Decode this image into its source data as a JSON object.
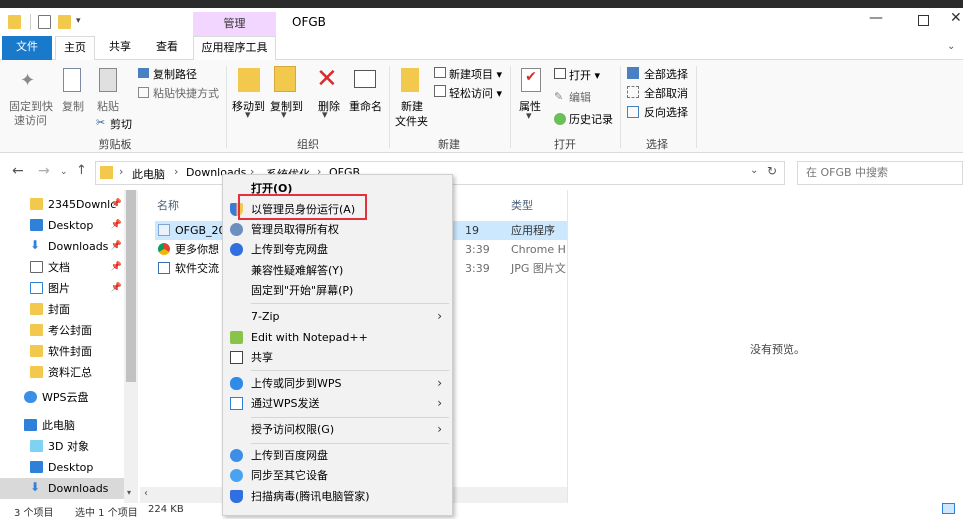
{
  "window": {
    "title": "OFGB",
    "context_tab_label": "管理",
    "colors": {
      "file_tab": "#1979ca",
      "context_tab": "#f2d6ff",
      "highlight": "#e3313d",
      "selected_row": "#cce8ff"
    }
  },
  "tabs": [
    {
      "label": "文件"
    },
    {
      "label": "主页"
    },
    {
      "label": "共享"
    },
    {
      "label": "查看"
    },
    {
      "label": "应用程序工具"
    }
  ],
  "ribbon": {
    "clipboard": {
      "pin_label_1": "固定到快",
      "pin_label_2": "速访问",
      "copy": "复制",
      "paste": "粘贴",
      "copy_path": "复制路径",
      "paste_shortcut": "粘贴快捷方式",
      "cut": "剪切",
      "group": "剪贴板"
    },
    "organize": {
      "move_to": "移动到",
      "copy_to": "复制到",
      "delete": "删除",
      "rename": "重命名",
      "group": "组织"
    },
    "new": {
      "new_folder_1": "新建",
      "new_folder_2": "文件夹",
      "new_item": "新建项目 ▾",
      "easy_access": "轻松访问 ▾",
      "group": "新建"
    },
    "open": {
      "properties": "属性",
      "open": "打开 ▾",
      "edit": "编辑",
      "history": "历史记录",
      "group": "打开"
    },
    "select": {
      "select_all": "全部选择",
      "select_none": "全部取消",
      "invert": "反向选择",
      "group": "选择"
    }
  },
  "address": {
    "segments": [
      "此电脑",
      "Downloads",
      "系统优化",
      "OFGB"
    ],
    "search_placeholder": "在 OFGB 中搜索"
  },
  "nav": {
    "items": [
      {
        "label": "2345Downlc",
        "icon": "folder-icon",
        "pinned": true
      },
      {
        "label": "Desktop",
        "icon": "desktop-icon",
        "pinned": true
      },
      {
        "label": "Downloads",
        "icon": "download-icon",
        "pinned": true
      },
      {
        "label": "文档",
        "icon": "document-icon",
        "pinned": true
      },
      {
        "label": "图片",
        "icon": "picture-icon",
        "pinned": true
      },
      {
        "label": "封面",
        "icon": "folder-icon",
        "pinned": false
      },
      {
        "label": "考公封面",
        "icon": "folder-icon",
        "pinned": false
      },
      {
        "label": "软件封面",
        "icon": "folder-icon",
        "pinned": false
      },
      {
        "label": "资料汇总",
        "icon": "folder-icon",
        "pinned": false
      },
      {
        "label": "WPS云盘",
        "icon": "cloud-icon",
        "pinned": false
      },
      {
        "label": "此电脑",
        "icon": "computer-icon",
        "pinned": false
      },
      {
        "label": "3D 对象",
        "icon": "3d-objects-icon",
        "pinned": false
      },
      {
        "label": "Desktop",
        "icon": "desktop-icon",
        "pinned": false
      },
      {
        "label": "Downloads",
        "icon": "download-icon",
        "pinned": false
      }
    ]
  },
  "files": {
    "col_name": "名称",
    "col_type": "类型",
    "rows": [
      {
        "name": "OFGB_20",
        "date": "19",
        "type": "应用程序",
        "icon": "app-icon"
      },
      {
        "name": "更多你想",
        "date": "3:39",
        "type": "Chrome H",
        "icon": "chrome-icon"
      },
      {
        "name": "软件交流",
        "date": "3:39",
        "type": "JPG 图片文",
        "icon": "jpg-icon"
      }
    ]
  },
  "preview": {
    "text": "没有预览。"
  },
  "status": {
    "count": "3 个项目",
    "selected": "选中 1 个项目",
    "size": "224 KB"
  },
  "context_menu": {
    "items": [
      {
        "label": "打开(O)",
        "bold": true
      },
      {
        "label": "以管理员身份运行(A)",
        "icon": "shield-icon"
      },
      {
        "label": "管理员取得所有权",
        "icon": "admin-icon"
      },
      {
        "label": "上传到夸克网盘",
        "icon": "quark-icon"
      },
      {
        "label": "兼容性疑难解答(Y)"
      },
      {
        "label": "固定到\"开始\"屏幕(P)"
      },
      {
        "label": "7-Zip",
        "submenu": true
      },
      {
        "label": "Edit with Notepad++",
        "icon": "notepad-icon"
      },
      {
        "label": "共享",
        "icon": "share-icon"
      },
      {
        "label": "上传或同步到WPS",
        "icon": "wps-cloud-icon",
        "submenu": true
      },
      {
        "label": "通过WPS发送",
        "icon": "wps-send-icon",
        "submenu": true
      },
      {
        "label": "授予访问权限(G)",
        "submenu": true
      },
      {
        "label": "上传到百度网盘",
        "icon": "baidu-icon"
      },
      {
        "label": "同步至其它设备",
        "icon": "sync-icon"
      },
      {
        "label": "扫描病毒(腾讯电脑管家)",
        "icon": "virus-scan-icon"
      }
    ]
  }
}
